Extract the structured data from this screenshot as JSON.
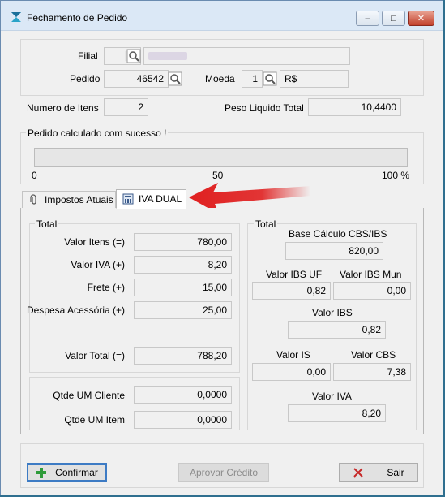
{
  "window": {
    "title": "Fechamento de Pedido",
    "minimize_glyph": "–",
    "maximize_glyph": "□",
    "close_glyph": "✕"
  },
  "header": {
    "filial_label": "Filial",
    "pedido_label": "Pedido",
    "pedido_value": "46542",
    "moeda_label": "Moeda",
    "moeda_code": "1",
    "moeda_symbol": "R$",
    "numero_itens_label": "Numero de Itens",
    "numero_itens_value": "2",
    "peso_label": "Peso Liquido Total",
    "peso_value": "10,4400"
  },
  "progress": {
    "message": "Pedido calculado com sucesso !",
    "tick_0": "0",
    "tick_50": "50",
    "tick_100": "100 %",
    "fraction": 0
  },
  "tabs": [
    {
      "label": "Impostos Atuais",
      "icon": "paperclip-icon"
    },
    {
      "label": "IVA DUAL",
      "icon": "calculator-icon"
    }
  ],
  "left_group": {
    "title": "Total",
    "valor_itens_label": "Valor Itens (=)",
    "valor_itens": "780,00",
    "valor_iva_label": "Valor IVA (+)",
    "valor_iva": "8,20",
    "frete_label": "Frete (+)",
    "frete": "15,00",
    "despesa_label": "Despesa Acessória (+)",
    "despesa": "25,00",
    "valor_total_label": "Valor Total (=)",
    "valor_total": "788,20",
    "qtde_cliente_label": "Qtde UM Cliente",
    "qtde_cliente": "0,0000",
    "qtde_item_label": "Qtde UM Item",
    "qtde_item": "0,0000"
  },
  "right_group": {
    "title": "Total",
    "base_label": "Base Cálculo CBS/IBS",
    "base_value": "820,00",
    "ibs_uf_label": "Valor IBS UF",
    "ibs_uf": "0,82",
    "ibs_mun_label": "Valor IBS Mun",
    "ibs_mun": "0,00",
    "ibs_label": "Valor IBS",
    "ibs": "0,82",
    "is_label": "Valor IS",
    "is_value": "0,00",
    "cbs_label": "Valor CBS",
    "cbs": "7,38",
    "iva_label": "Valor IVA",
    "iva": "8,20"
  },
  "buttons": {
    "confirmar": "Confirmar",
    "aprovar": "Aprovar Crédito",
    "sair": "Sair"
  },
  "colors": {
    "arrow": "#e02020",
    "confirm_plus": "#2e9b3a",
    "sair_x": "#c62828"
  }
}
